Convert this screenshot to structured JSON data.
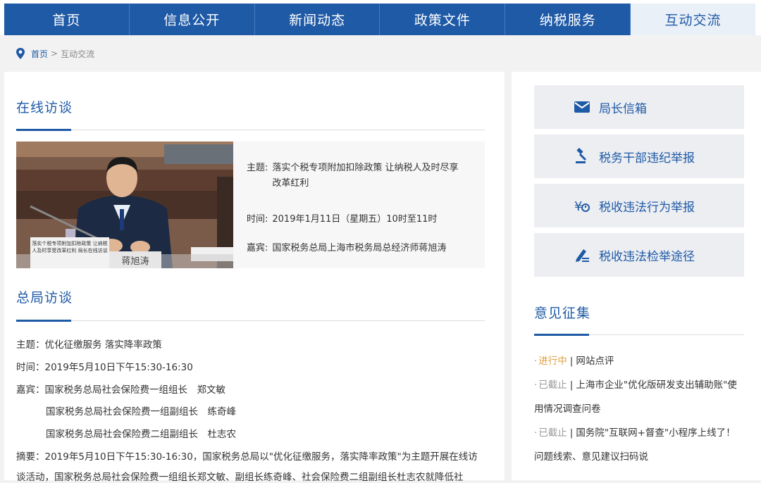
{
  "nav": {
    "items": [
      {
        "label": "首页"
      },
      {
        "label": "信息公开"
      },
      {
        "label": "新闻动态"
      },
      {
        "label": "政策文件"
      },
      {
        "label": "纳税服务"
      },
      {
        "label": "互动交流"
      }
    ],
    "active_index": 5
  },
  "breadcrumb": {
    "home": "首页",
    "sep": ">",
    "current": "互动交流"
  },
  "online": {
    "title": "在线访谈",
    "photo_caption": "蒋旭涛",
    "photo_sign": "落实个税专项附加扣除政策 让纳税人及时享受改革红利 局长在线访谈",
    "topic_label": "主题:",
    "topic": "落实个税专项附加扣除政策 让纳税人及时尽享改革红利",
    "time_label": "时间:",
    "time": "2019年1月11日（星期五）10时至11时",
    "guest_label": "嘉宾:",
    "guest": "国家税务总局上海市税务局总经济师蒋旭涛"
  },
  "bureau": {
    "title": "总局访谈",
    "topic": "主题：优化征缴服务 落实降率政策",
    "time": "时间：2019年5月10日下午15:30-16:30",
    "guest1": "嘉宾：国家税务总局社会保险费一组组长　郑文敏",
    "guest2": "国家税务总局社会保险费一组副组长　练奇峰",
    "guest3": "国家税务总局社会保险费二组副组长　杜志农",
    "summary": "摘要：2019年5月10日下午15:30-16:30，国家税务总局以\"优化征缴服务，落实降率政策\"为主题开展在线访",
    "summary2": "谈活动，国家税务总局社会保险费一组组长郑文敏、副组长练奇峰、社会保险费二组副组长杜志农就降低社"
  },
  "services": [
    {
      "label": "局长信箱",
      "icon": "mail-icon"
    },
    {
      "label": "税务干部违纪举报",
      "icon": "gavel-icon"
    },
    {
      "label": "税收违法行为举报",
      "icon": "report-icon"
    },
    {
      "label": "税收违法检举途径",
      "icon": "pen-icon"
    }
  ],
  "opinion": {
    "title": "意见征集",
    "items": [
      {
        "status": "进行中",
        "text": "网站点评",
        "state": "active"
      },
      {
        "status": "已截止",
        "text": "上海市企业\"优化版研发支出辅助账\"使",
        "text2": "用情况调查问卷",
        "state": "closed"
      },
      {
        "status": "已截止",
        "text": "国务院\"互联网+督查\"小程序上线了！",
        "text2": "问题线索、意见建议扫码说",
        "state": "closed"
      }
    ]
  },
  "colors": {
    "brand": "#1f5aa6",
    "active_status": "#e0a040"
  }
}
